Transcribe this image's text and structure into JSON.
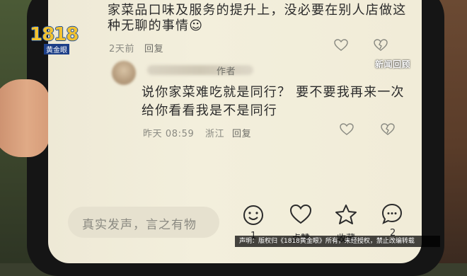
{
  "watermark": {
    "logo_number": "1818",
    "logo_text": "黄金眼",
    "news_tag": "新闻回顾",
    "disclaimer": "声明：版权归《1818黄金眼》所有，未经授权，禁止改编转载"
  },
  "comments": [
    {
      "text_lines": [
        "家菜品口味及服务的提升上，没必要在别人店做这",
        "种无聊的事情☺"
      ],
      "time": "2天前",
      "reply_label": "回复"
    },
    {
      "author_tag": "作者",
      "text_lines": [
        "说你家菜难吃就是同行？ 要不要我再来一次",
        "给你看看我是不是同行"
      ],
      "time": "昨天 08:59",
      "location": "浙江",
      "reply_label": "回复"
    }
  ],
  "bottom_bar": {
    "input_placeholder": "真实发声，言之有物",
    "actions": [
      {
        "icon": "emoji-icon",
        "count": "1"
      },
      {
        "icon": "heart-icon",
        "label": "点赞"
      },
      {
        "icon": "star-icon",
        "label": "收藏"
      },
      {
        "icon": "comment-icon",
        "count": "2"
      }
    ]
  }
}
